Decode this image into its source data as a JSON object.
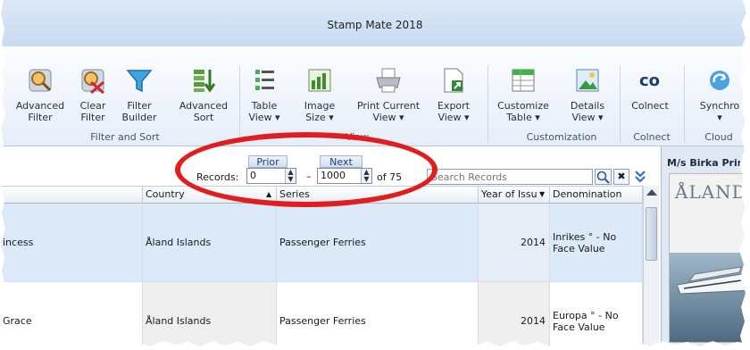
{
  "app": {
    "title": "Stamp Mate 2018"
  },
  "ribbon": {
    "groups": {
      "filter_sort": "Filter and Sort",
      "view": "View",
      "customization": "Customization",
      "colnect": "Colnect",
      "cloud": "Cloud"
    },
    "buttons": {
      "advanced_filter": [
        "Advanced",
        "Filter"
      ],
      "clear_filter": [
        "Clear",
        "Filter"
      ],
      "filter_builder": [
        "Filter",
        "Builder"
      ],
      "advanced_sort": [
        "Advanced",
        "Sort"
      ],
      "table_view": [
        "Table",
        "View ▾"
      ],
      "image_size": [
        "Image",
        "Size ▾"
      ],
      "print_current_view": [
        "Print Current",
        "View ▾"
      ],
      "export_view": [
        "Export",
        "View ▾"
      ],
      "customize_table": [
        "Customize",
        "Table ▾"
      ],
      "details_view": [
        "Details",
        "View ▾"
      ],
      "colnect": [
        "Colnect",
        ""
      ],
      "synchro": [
        "Synchro",
        "▾"
      ]
    }
  },
  "records": {
    "label": "Records:",
    "prior_label": "Prior",
    "next_label": "Next",
    "from": "0",
    "to": "1000",
    "dash": "–",
    "of_text": "of 75",
    "search_placeholder": "Search Records"
  },
  "grid": {
    "columns": [
      "",
      "Country",
      "Series",
      "Year of Issu",
      "Denomination"
    ],
    "rows": [
      {
        "name": "incess",
        "country": "Åland Islands",
        "series": "Passenger Ferries",
        "year": "2014",
        "denomination": "Inrikes ° - No Face Value"
      },
      {
        "name": "Grace",
        "country": "Åland Islands",
        "series": "Passenger Ferries",
        "year": "2014",
        "denomination": "Europa ° - No Face Value"
      }
    ]
  },
  "detail_panel": {
    "title": "M/s Birka Prince",
    "stamp_text": "ÅLAND"
  },
  "colors": {
    "selection": "#dbe9f9",
    "annotation_ellipse": "#e21d1d",
    "ribbon_bg": "#e6eef9"
  }
}
